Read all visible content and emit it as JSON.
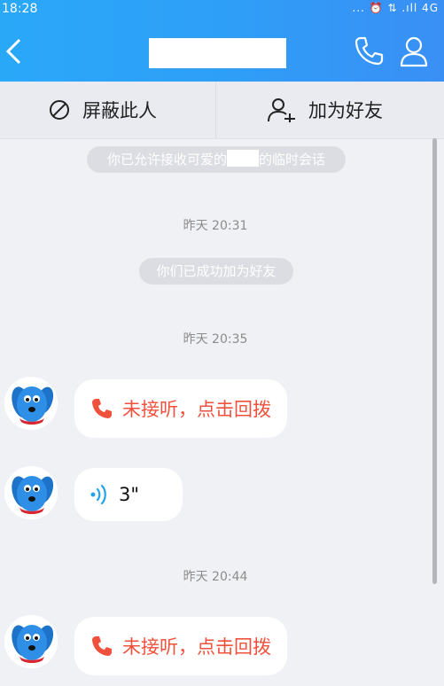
{
  "status_bar": {
    "time": "18:28",
    "indicators": "... ⏰ ⇅ .ıll 4G"
  },
  "header": {
    "back_icon": "back-arrow-icon",
    "title": "",
    "call_icon": "phone-icon",
    "profile_icon": "person-icon"
  },
  "actions": {
    "block_label": "屏蔽此人",
    "add_friend_label": "加为好友"
  },
  "messages": {
    "notice_allowed_prefix": "你已允许接收可爱的",
    "notice_allowed_suffix": "的临时会话",
    "ts1": "昨天 20:31",
    "notice_friends": "你们已成功加为好友",
    "ts2": "昨天 20:35",
    "missed1": "未接听，点击回拨",
    "voice_duration": "3\"",
    "ts3": "昨天 20:44",
    "missed2": "未接听，点击回拨"
  },
  "colors": {
    "header_blue": "#2e9ff7",
    "missed_red": "#f0513c",
    "voice_blue": "#1fa3f0"
  }
}
